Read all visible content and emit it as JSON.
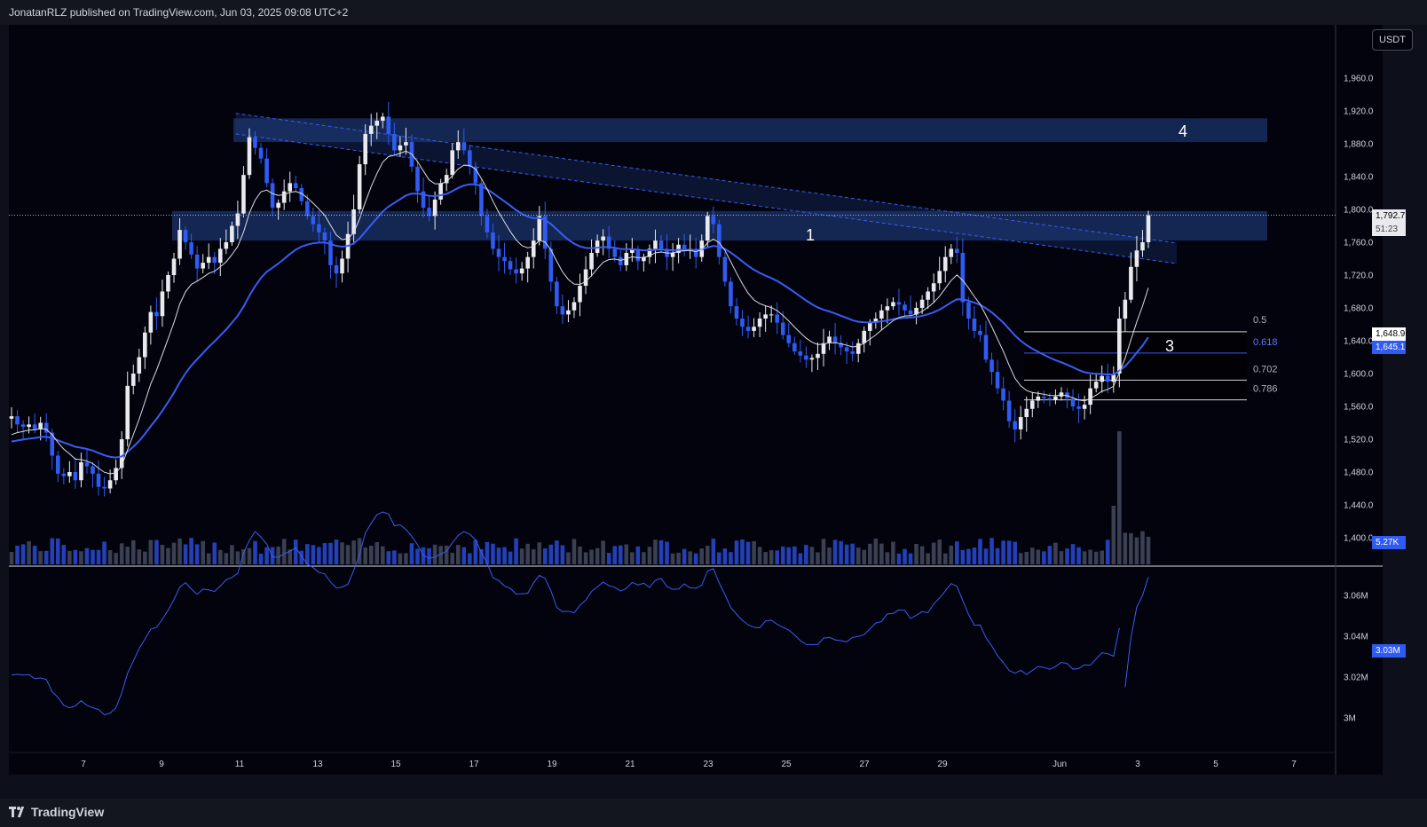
{
  "header": {
    "publisher_line": "JonatanRLZ published on TradingView.com, Jun 03, 2025 09:08 UTC+2"
  },
  "footer": {
    "brand": "TradingView"
  },
  "scale_label": "USDT",
  "colors": {
    "bull": "#e9e9ee",
    "bear": "#2f5bf2",
    "ema_slow": "#3a5cf5",
    "ema_fast": "#dcdce4",
    "zone": "#1e3a78",
    "rsi_line": "#3a5cf5",
    "background": "#02030c"
  },
  "price_tags": {
    "last_price": "1,792.7",
    "countdown": "51:23",
    "fast_ma": "1,648.9",
    "slow_ma": "1,645.1",
    "volume": "5.27K",
    "indicator": "3.03M"
  },
  "annotations": {
    "zone_1": "1",
    "level_3": "3",
    "zone_4": "4"
  },
  "fib_labels": [
    "0.5",
    "0.618",
    "0.702",
    "0.786"
  ],
  "chart_data": [
    {
      "type": "candlestick",
      "title": "",
      "ylim": [
        1400,
        1990
      ],
      "y_ticks": [
        "1,960.0",
        "1,920.0",
        "1,880.0",
        "1,840.0",
        "1,800.0",
        "1,760.0",
        "1,720.0",
        "1,680.0",
        "1,640.0",
        "1,600.0",
        "1,560.0",
        "1,520.0",
        "1,480.0",
        "1,440.0",
        "1,400.0"
      ],
      "x_ticks": [
        "7",
        "9",
        "11",
        "13",
        "15",
        "17",
        "19",
        "21",
        "23",
        "25",
        "27",
        "29",
        "Jun",
        "3",
        "5",
        "7"
      ],
      "x_tick_days": [
        7,
        9,
        11,
        13,
        15,
        17,
        19,
        21,
        23,
        25,
        27,
        29,
        32,
        34,
        36,
        38
      ],
      "x_range_days": [
        5.2,
        39
      ],
      "closes": [
        1548,
        1538,
        1535,
        1538,
        1532,
        1540,
        1528,
        1500,
        1478,
        1475,
        1480,
        1470,
        1492,
        1487,
        1478,
        1462,
        1460,
        1470,
        1485,
        1520,
        1585,
        1600,
        1620,
        1650,
        1675,
        1670,
        1700,
        1720,
        1740,
        1775,
        1760,
        1745,
        1728,
        1735,
        1742,
        1735,
        1752,
        1760,
        1780,
        1795,
        1842,
        1888,
        1875,
        1862,
        1832,
        1802,
        1808,
        1822,
        1832,
        1826,
        1810,
        1792,
        1782,
        1772,
        1762,
        1732,
        1722,
        1740,
        1770,
        1800,
        1855,
        1892,
        1902,
        1908,
        1913,
        1892,
        1872,
        1878,
        1882,
        1852,
        1822,
        1802,
        1792,
        1812,
        1832,
        1842,
        1872,
        1882,
        1872,
        1852,
        1832,
        1792,
        1772,
        1752,
        1742,
        1737,
        1727,
        1722,
        1728,
        1742,
        1762,
        1792,
        1752,
        1712,
        1682,
        1672,
        1677,
        1687,
        1707,
        1727,
        1747,
        1762,
        1767,
        1752,
        1742,
        1732,
        1747,
        1752,
        1737,
        1742,
        1752,
        1762,
        1752,
        1742,
        1747,
        1757,
        1752,
        1752,
        1742,
        1762,
        1792,
        1782,
        1742,
        1712,
        1682,
        1667,
        1657,
        1652,
        1657,
        1667,
        1672,
        1672,
        1662,
        1647,
        1637,
        1627,
        1622,
        1617,
        1619,
        1624,
        1637,
        1645,
        1637,
        1632,
        1627,
        1624,
        1637,
        1652,
        1662,
        1667,
        1677,
        1682,
        1687,
        1684,
        1677,
        1672,
        1680,
        1690,
        1700,
        1710,
        1725,
        1742,
        1752,
        1747,
        1687,
        1667,
        1652,
        1647,
        1617,
        1602,
        1582,
        1567,
        1542,
        1532,
        1547,
        1557,
        1567,
        1572,
        1570,
        1568,
        1572,
        1577,
        1570,
        1560,
        1557,
        1562,
        1582,
        1590,
        1597,
        1590,
        1600,
        1667,
        1690,
        1730,
        1750,
        1760,
        1793
      ],
      "ema_fast_start": 1520,
      "ema_slow_start": 1515,
      "zones": [
        {
          "label": "1",
          "from": 1762,
          "to": 1798
        },
        {
          "label": "4",
          "from": 1882,
          "to": 1911
        }
      ],
      "fib_levels": [
        {
          "label": "0.5",
          "price": 1651
        },
        {
          "label": "0.618",
          "price": 1625
        },
        {
          "label": "0.702",
          "price": 1592
        },
        {
          "label": "0.786",
          "price": 1568
        }
      ],
      "trendlines": [
        {
          "from": [
            10.9,
            1917
          ],
          "to": [
            35,
            1759
          ]
        },
        {
          "from": [
            10.9,
            1892
          ],
          "to": [
            35,
            1734
          ]
        }
      ]
    },
    {
      "type": "bar",
      "title": "Volume",
      "note": "volume bars: white = up bar, blue = down bar",
      "last_value": "5.27K",
      "spike_at_day": 33.5
    },
    {
      "type": "line",
      "title": "",
      "y_ticks": [
        "3.06M",
        "3.04M",
        "3.02M",
        "3M"
      ],
      "ylim": [
        2.99,
        3.07
      ],
      "last_value": "3.03M"
    }
  ]
}
